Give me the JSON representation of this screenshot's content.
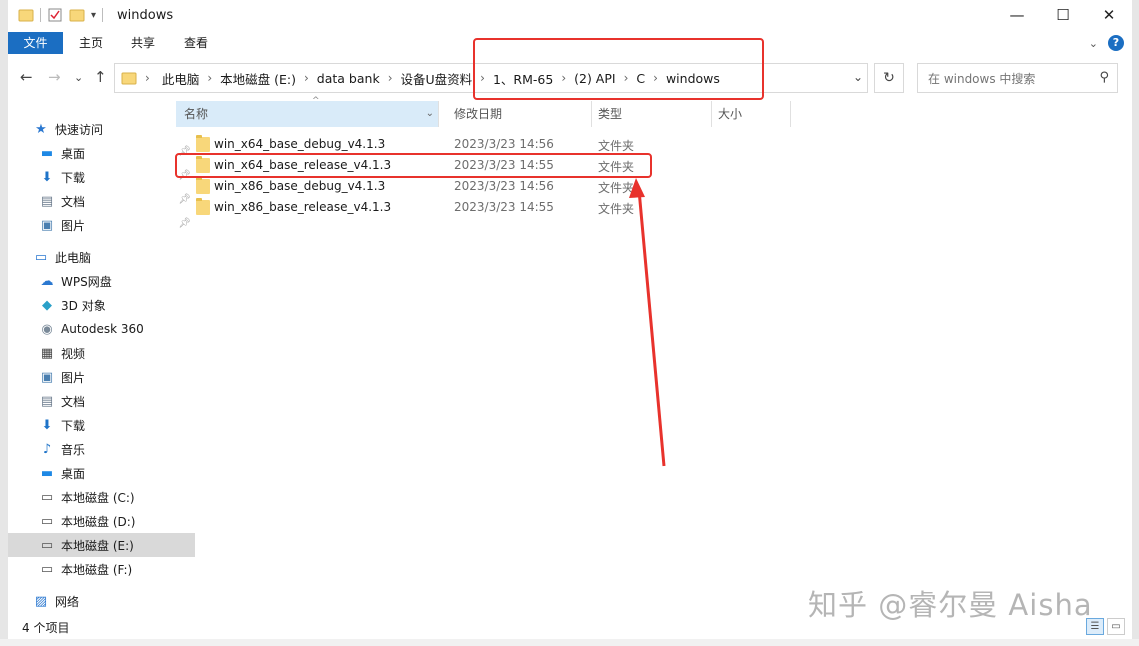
{
  "window": {
    "title": "windows"
  },
  "title_controls": {
    "minimize": "—",
    "maximize": "☐",
    "close": "✕"
  },
  "ribbon": {
    "tabs": [
      {
        "label": "文件"
      },
      {
        "label": "主页"
      },
      {
        "label": "共享"
      },
      {
        "label": "查看"
      }
    ],
    "help": "?"
  },
  "address": {
    "crumbs": [
      "此电脑",
      "本地磁盘 (E:)",
      "data bank",
      "设备U盘资料",
      "1、RM-65",
      "(2) API",
      "C",
      "windows"
    ]
  },
  "search": {
    "placeholder": "在 windows 中搜索"
  },
  "sidebar": {
    "items": [
      {
        "label": "快速访问",
        "icon": "star-icon",
        "glyph": "★",
        "color": "#2b78d0"
      },
      {
        "label": "桌面",
        "icon": "desktop-icon",
        "glyph": "▬",
        "color": "#1e88e5"
      },
      {
        "label": "下载",
        "icon": "download-icon",
        "glyph": "⬇",
        "color": "#1e73c8"
      },
      {
        "label": "文档",
        "icon": "document-icon",
        "glyph": "▤",
        "color": "#6b7b8c"
      },
      {
        "label": "图片",
        "icon": "picture-icon",
        "glyph": "▣",
        "color": "#4a7fb0"
      },
      {
        "label": "此电脑",
        "icon": "computer-icon",
        "glyph": "▭",
        "color": "#2b78d0"
      },
      {
        "label": "WPS网盘",
        "icon": "cloud-icon",
        "glyph": "☁",
        "color": "#2b78d0"
      },
      {
        "label": "3D 对象",
        "icon": "cube-icon",
        "glyph": "◆",
        "color": "#2aa0c8"
      },
      {
        "label": "Autodesk 360",
        "icon": "autodesk-icon",
        "glyph": "◉",
        "color": "#7a8a99"
      },
      {
        "label": "视频",
        "icon": "video-icon",
        "glyph": "▦",
        "color": "#444444"
      },
      {
        "label": "图片",
        "icon": "picture-icon",
        "glyph": "▣",
        "color": "#4a7fb0"
      },
      {
        "label": "文档",
        "icon": "document-icon",
        "glyph": "▤",
        "color": "#6b7b8c"
      },
      {
        "label": "下载",
        "icon": "download-icon",
        "glyph": "⬇",
        "color": "#1e73c8"
      },
      {
        "label": "音乐",
        "icon": "music-icon",
        "glyph": "♪",
        "color": "#1e73c8"
      },
      {
        "label": "桌面",
        "icon": "desktop-icon",
        "glyph": "▬",
        "color": "#1e88e5"
      },
      {
        "label": "本地磁盘 (C:)",
        "icon": "drive-icon",
        "glyph": "▭",
        "color": "#555555"
      },
      {
        "label": "本地磁盘 (D:)",
        "icon": "drive-icon",
        "glyph": "▭",
        "color": "#555555"
      },
      {
        "label": "本地磁盘 (E:)",
        "icon": "drive-icon",
        "glyph": "▭",
        "color": "#555555"
      },
      {
        "label": "本地磁盘 (F:)",
        "icon": "drive-icon",
        "glyph": "▭",
        "color": "#555555"
      },
      {
        "label": "网络",
        "icon": "network-icon",
        "glyph": "▨",
        "color": "#2b78d0"
      }
    ],
    "selected": "本地磁盘 (E:)"
  },
  "columns": {
    "name": "名称",
    "date": "修改日期",
    "type": "类型",
    "size": "大小"
  },
  "files": [
    {
      "name": "win_x64_base_debug_v4.1.3",
      "date": "2023/3/23 14:56",
      "type": "文件夹"
    },
    {
      "name": "win_x64_base_release_v4.1.3",
      "date": "2023/3/23 14:55",
      "type": "文件夹"
    },
    {
      "name": "win_x86_base_debug_v4.1.3",
      "date": "2023/3/23 14:56",
      "type": "文件夹"
    },
    {
      "name": "win_x86_base_release_v4.1.3",
      "date": "2023/3/23 14:55",
      "type": "文件夹"
    }
  ],
  "status": {
    "count": "4 个项目"
  },
  "colors": {
    "accent": "#1b6ec2",
    "annotation": "#e8322c",
    "folder": "#f8d77a"
  },
  "watermark": {
    "text": "知乎 @睿尔曼 Aisha"
  }
}
